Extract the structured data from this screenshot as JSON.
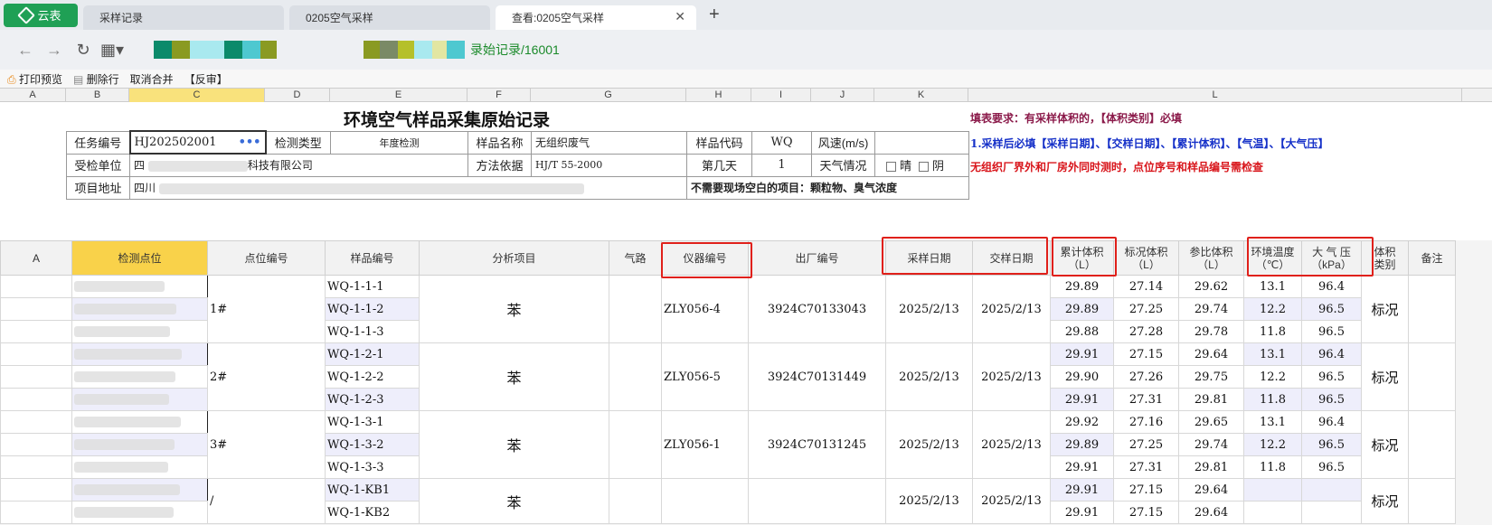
{
  "app": {
    "logo": "云表"
  },
  "tabs": [
    {
      "label": "采样记录"
    },
    {
      "label": "0205空气采样"
    },
    {
      "label": "查看:0205空气采样"
    }
  ],
  "addr": {
    "crumb": "录始记录/16001"
  },
  "toolbar": {
    "print": "打印预览",
    "delete_row": "删除行",
    "unmerge": "取消合并",
    "reverse": "【反审】"
  },
  "colhdr": [
    "A",
    "B",
    "C",
    "D",
    "E",
    "F",
    "G",
    "H",
    "I",
    "J",
    "K",
    "L"
  ],
  "form": {
    "title": "环境空气样品采集原始记录",
    "task_no_label": "任务编号",
    "task_no": "HJ202502001",
    "detect_type_label": "检测类型",
    "detect_type": "年度检测",
    "sample_name_label": "样品名称",
    "sample_name": "无组织废气",
    "sample_code_label": "样品代码",
    "sample_code": "WQ",
    "wind_label": "风速(m/s)",
    "unit_label": "受检单位",
    "unit_suffix": "科技有限公司",
    "unit_prefix": "四",
    "method_label": "方法依据",
    "method": "HJ/T 55-2000",
    "day_label": "第几天",
    "day": "1",
    "weather_label": "天气情况",
    "sunny": "晴",
    "cloudy": "阴",
    "addr_label": "项目地址",
    "addr_prefix": "四川",
    "no_field": "不需要现场空白的项目：颗粒物、臭气浓度",
    "note1": "填表要求：有采样体积的，【体积类别】必填",
    "note2": "1.采样后必填【采样日期】、【交样日期】、【累计体积】、【气温】、【大气压】",
    "note3": "无组织厂界外和厂房外同时测时，点位序号和样品编号需检查"
  },
  "table": {
    "headers": [
      "A",
      "检测点位",
      "点位编号",
      "样品编号",
      "分析项目",
      "气路",
      "仪器编号",
      "出厂编号",
      "采样日期",
      "交样日期",
      "累计体积\n（L）",
      "标况体积\n（L）",
      "参比体积\n（L）",
      "环境温度\n（℃）",
      "大 气 压\n（kPa）",
      "体积\n类别",
      "备注"
    ],
    "groups": [
      {
        "point_no": "1#",
        "analyte": "苯",
        "instrument": "ZLY056-4",
        "factory_no": "3924C70133043",
        "sample_date": "2025/2/13",
        "deliver_date": "2025/2/13",
        "vol_type": "标况",
        "rows": [
          {
            "sample_no": "WQ-1-1-1",
            "cum": "29.89",
            "std": "27.14",
            "ref": "29.62",
            "temp": "13.1",
            "press": "96.4"
          },
          {
            "sample_no": "WQ-1-1-2",
            "cum": "29.89",
            "std": "27.25",
            "ref": "29.74",
            "temp": "12.2",
            "press": "96.5"
          },
          {
            "sample_no": "WQ-1-1-3",
            "cum": "29.88",
            "std": "27.28",
            "ref": "29.78",
            "temp": "11.8",
            "press": "96.5"
          }
        ]
      },
      {
        "point_no": "2#",
        "analyte": "苯",
        "instrument": "ZLY056-5",
        "factory_no": "3924C70131449",
        "sample_date": "2025/2/13",
        "deliver_date": "2025/2/13",
        "vol_type": "标况",
        "rows": [
          {
            "sample_no": "WQ-1-2-1",
            "cum": "29.91",
            "std": "27.15",
            "ref": "29.64",
            "temp": "13.1",
            "press": "96.4"
          },
          {
            "sample_no": "WQ-1-2-2",
            "cum": "29.90",
            "std": "27.26",
            "ref": "29.75",
            "temp": "12.2",
            "press": "96.5"
          },
          {
            "sample_no": "WQ-1-2-3",
            "cum": "29.91",
            "std": "27.31",
            "ref": "29.81",
            "temp": "11.8",
            "press": "96.5"
          }
        ]
      },
      {
        "point_no": "3#",
        "analyte": "苯",
        "instrument": "ZLY056-1",
        "factory_no": "3924C70131245",
        "sample_date": "2025/2/13",
        "deliver_date": "2025/2/13",
        "vol_type": "标况",
        "rows": [
          {
            "sample_no": "WQ-1-3-1",
            "cum": "29.92",
            "std": "27.16",
            "ref": "29.65",
            "temp": "13.1",
            "press": "96.4"
          },
          {
            "sample_no": "WQ-1-3-2",
            "cum": "29.89",
            "std": "27.25",
            "ref": "29.74",
            "temp": "12.2",
            "press": "96.5"
          },
          {
            "sample_no": "WQ-1-3-3",
            "cum": "29.91",
            "std": "27.31",
            "ref": "29.81",
            "temp": "11.8",
            "press": "96.5"
          }
        ]
      },
      {
        "point_no": "/",
        "analyte": "苯",
        "instrument": "",
        "factory_no": "",
        "sample_date": "2025/2/13",
        "deliver_date": "2025/2/13",
        "vol_type": "标况",
        "rows": [
          {
            "sample_no": "WQ-1-KB1",
            "cum": "29.91",
            "std": "27.15",
            "ref": "29.64",
            "temp": "",
            "press": ""
          },
          {
            "sample_no": "WQ-1-KB2",
            "cum": "29.91",
            "std": "27.15",
            "ref": "29.64",
            "temp": "",
            "press": ""
          }
        ]
      }
    ]
  }
}
